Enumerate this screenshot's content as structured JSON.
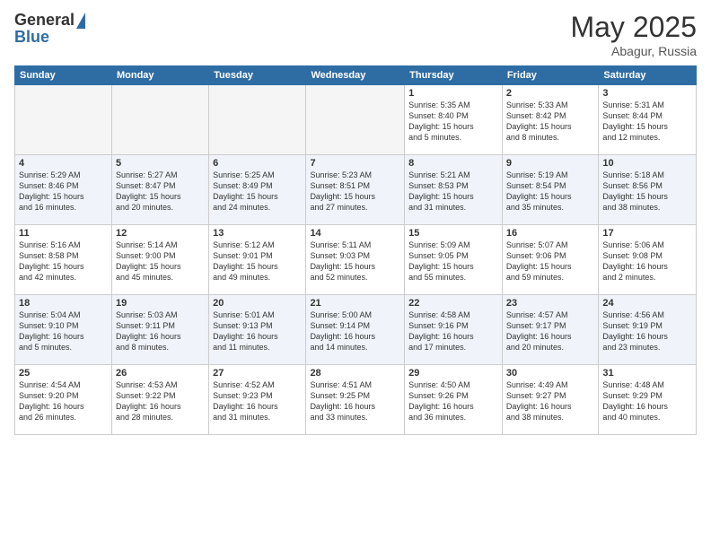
{
  "logo": {
    "general": "General",
    "blue": "Blue"
  },
  "title": {
    "month_year": "May 2025",
    "location": "Abagur, Russia"
  },
  "weekdays": [
    "Sunday",
    "Monday",
    "Tuesday",
    "Wednesday",
    "Thursday",
    "Friday",
    "Saturday"
  ],
  "rows": [
    [
      {
        "day": "",
        "text": ""
      },
      {
        "day": "",
        "text": ""
      },
      {
        "day": "",
        "text": ""
      },
      {
        "day": "",
        "text": ""
      },
      {
        "day": "1",
        "text": "Sunrise: 5:35 AM\nSunset: 8:40 PM\nDaylight: 15 hours\nand 5 minutes."
      },
      {
        "day": "2",
        "text": "Sunrise: 5:33 AM\nSunset: 8:42 PM\nDaylight: 15 hours\nand 8 minutes."
      },
      {
        "day": "3",
        "text": "Sunrise: 5:31 AM\nSunset: 8:44 PM\nDaylight: 15 hours\nand 12 minutes."
      }
    ],
    [
      {
        "day": "4",
        "text": "Sunrise: 5:29 AM\nSunset: 8:46 PM\nDaylight: 15 hours\nand 16 minutes."
      },
      {
        "day": "5",
        "text": "Sunrise: 5:27 AM\nSunset: 8:47 PM\nDaylight: 15 hours\nand 20 minutes."
      },
      {
        "day": "6",
        "text": "Sunrise: 5:25 AM\nSunset: 8:49 PM\nDaylight: 15 hours\nand 24 minutes."
      },
      {
        "day": "7",
        "text": "Sunrise: 5:23 AM\nSunset: 8:51 PM\nDaylight: 15 hours\nand 27 minutes."
      },
      {
        "day": "8",
        "text": "Sunrise: 5:21 AM\nSunset: 8:53 PM\nDaylight: 15 hours\nand 31 minutes."
      },
      {
        "day": "9",
        "text": "Sunrise: 5:19 AM\nSunset: 8:54 PM\nDaylight: 15 hours\nand 35 minutes."
      },
      {
        "day": "10",
        "text": "Sunrise: 5:18 AM\nSunset: 8:56 PM\nDaylight: 15 hours\nand 38 minutes."
      }
    ],
    [
      {
        "day": "11",
        "text": "Sunrise: 5:16 AM\nSunset: 8:58 PM\nDaylight: 15 hours\nand 42 minutes."
      },
      {
        "day": "12",
        "text": "Sunrise: 5:14 AM\nSunset: 9:00 PM\nDaylight: 15 hours\nand 45 minutes."
      },
      {
        "day": "13",
        "text": "Sunrise: 5:12 AM\nSunset: 9:01 PM\nDaylight: 15 hours\nand 49 minutes."
      },
      {
        "day": "14",
        "text": "Sunrise: 5:11 AM\nSunset: 9:03 PM\nDaylight: 15 hours\nand 52 minutes."
      },
      {
        "day": "15",
        "text": "Sunrise: 5:09 AM\nSunset: 9:05 PM\nDaylight: 15 hours\nand 55 minutes."
      },
      {
        "day": "16",
        "text": "Sunrise: 5:07 AM\nSunset: 9:06 PM\nDaylight: 15 hours\nand 59 minutes."
      },
      {
        "day": "17",
        "text": "Sunrise: 5:06 AM\nSunset: 9:08 PM\nDaylight: 16 hours\nand 2 minutes."
      }
    ],
    [
      {
        "day": "18",
        "text": "Sunrise: 5:04 AM\nSunset: 9:10 PM\nDaylight: 16 hours\nand 5 minutes."
      },
      {
        "day": "19",
        "text": "Sunrise: 5:03 AM\nSunset: 9:11 PM\nDaylight: 16 hours\nand 8 minutes."
      },
      {
        "day": "20",
        "text": "Sunrise: 5:01 AM\nSunset: 9:13 PM\nDaylight: 16 hours\nand 11 minutes."
      },
      {
        "day": "21",
        "text": "Sunrise: 5:00 AM\nSunset: 9:14 PM\nDaylight: 16 hours\nand 14 minutes."
      },
      {
        "day": "22",
        "text": "Sunrise: 4:58 AM\nSunset: 9:16 PM\nDaylight: 16 hours\nand 17 minutes."
      },
      {
        "day": "23",
        "text": "Sunrise: 4:57 AM\nSunset: 9:17 PM\nDaylight: 16 hours\nand 20 minutes."
      },
      {
        "day": "24",
        "text": "Sunrise: 4:56 AM\nSunset: 9:19 PM\nDaylight: 16 hours\nand 23 minutes."
      }
    ],
    [
      {
        "day": "25",
        "text": "Sunrise: 4:54 AM\nSunset: 9:20 PM\nDaylight: 16 hours\nand 26 minutes."
      },
      {
        "day": "26",
        "text": "Sunrise: 4:53 AM\nSunset: 9:22 PM\nDaylight: 16 hours\nand 28 minutes."
      },
      {
        "day": "27",
        "text": "Sunrise: 4:52 AM\nSunset: 9:23 PM\nDaylight: 16 hours\nand 31 minutes."
      },
      {
        "day": "28",
        "text": "Sunrise: 4:51 AM\nSunset: 9:25 PM\nDaylight: 16 hours\nand 33 minutes."
      },
      {
        "day": "29",
        "text": "Sunrise: 4:50 AM\nSunset: 9:26 PM\nDaylight: 16 hours\nand 36 minutes."
      },
      {
        "day": "30",
        "text": "Sunrise: 4:49 AM\nSunset: 9:27 PM\nDaylight: 16 hours\nand 38 minutes."
      },
      {
        "day": "31",
        "text": "Sunrise: 4:48 AM\nSunset: 9:29 PM\nDaylight: 16 hours\nand 40 minutes."
      }
    ]
  ]
}
